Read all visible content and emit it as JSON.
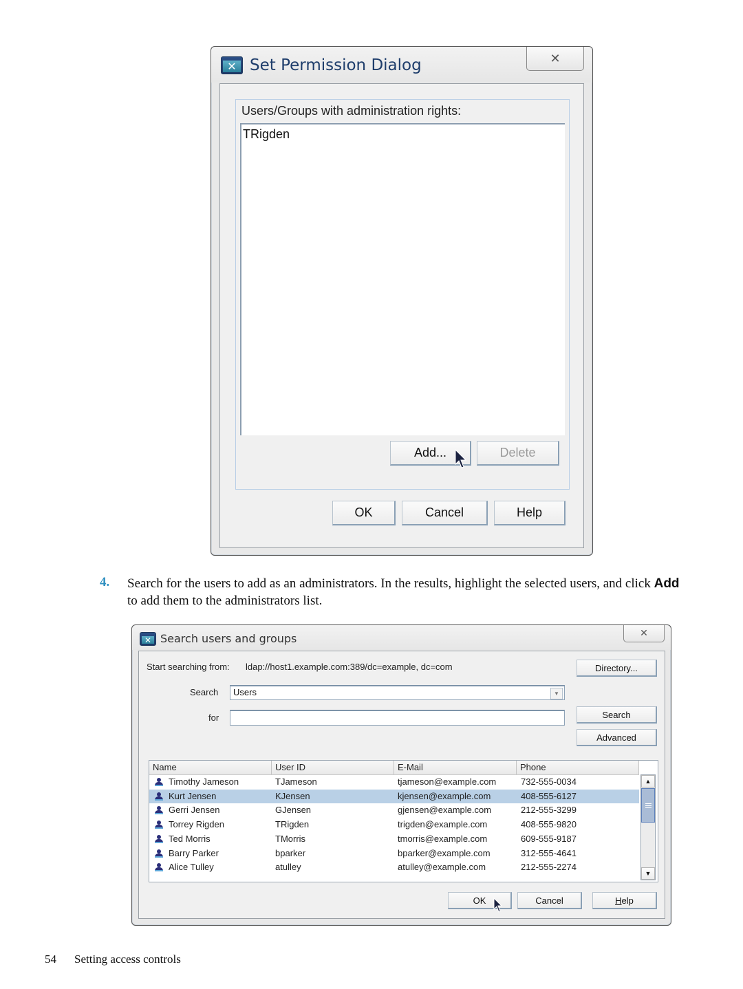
{
  "dialog1": {
    "title": "Set Permission Dialog",
    "close_glyph": "✕",
    "group_label": "Users/Groups with administration rights:",
    "admins": [
      "TRigden"
    ],
    "buttons": {
      "add": "Add...",
      "delete": "Delete",
      "ok": "OK",
      "cancel": "Cancel",
      "help": "Help"
    }
  },
  "instruction": {
    "step_number": "4.",
    "text_before": "Search for the users to add as an administrators. In the results, highlight the selected users, and click ",
    "bold": "Add",
    "text_after": " to add them to the administrators list."
  },
  "dialog2": {
    "title": "Search users and groups",
    "close_glyph": "✕",
    "start_label": "Start searching from:",
    "start_value": "ldap://host1.example.com:389/dc=example, dc=com",
    "search_label": "Search",
    "search_value": "Users",
    "for_label": "for",
    "for_value": "",
    "buttons": {
      "directory": "Directory...",
      "search": "Search",
      "advanced": "Advanced",
      "ok": "OK",
      "cancel": "Cancel",
      "help": "Help"
    },
    "columns": [
      "Name",
      "User ID",
      "E-Mail",
      "Phone"
    ],
    "rows": [
      {
        "name": "Timothy Jameson",
        "uid": "TJameson",
        "email": "tjameson@example.com",
        "phone": "732-555-0034",
        "selected": false
      },
      {
        "name": "Kurt Jensen",
        "uid": "KJensen",
        "email": "kjensen@example.com",
        "phone": "408-555-6127",
        "selected": true
      },
      {
        "name": "Gerri Jensen",
        "uid": "GJensen",
        "email": "gjensen@example.com",
        "phone": "212-555-3299",
        "selected": false
      },
      {
        "name": "Torrey Rigden",
        "uid": "TRigden",
        "email": "trigden@example.com",
        "phone": "408-555-9820",
        "selected": false
      },
      {
        "name": "Ted Morris",
        "uid": "TMorris",
        "email": "tmorris@example.com",
        "phone": "609-555-9187",
        "selected": false
      },
      {
        "name": "Barry Parker",
        "uid": "bparker",
        "email": "bparker@example.com",
        "phone": "312-555-4641",
        "selected": false
      },
      {
        "name": "Alice Tulley",
        "uid": "atulley",
        "email": "atulley@example.com",
        "phone": "212-555-2274",
        "selected": false
      }
    ],
    "scroll_arrows": {
      "up": "▲",
      "down": "▼"
    },
    "dropdown_arrow": "▼"
  },
  "footer": {
    "page_number": "54",
    "section": "Setting access controls"
  },
  "colors": {
    "selection": "#b9d0e6",
    "title_blue": "#1e3d6b",
    "step_blue": "#2f8fc0"
  }
}
